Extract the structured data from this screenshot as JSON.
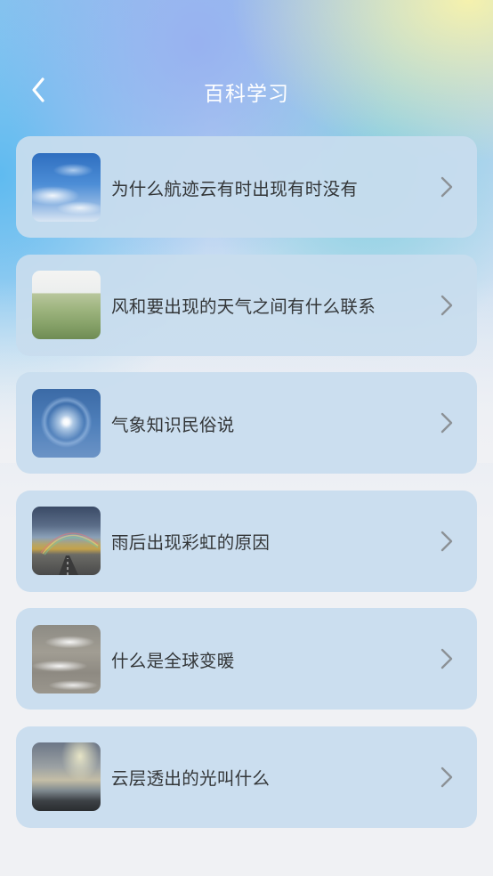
{
  "header": {
    "title": "百科学习",
    "back_icon": "chevron-left-icon"
  },
  "items": [
    {
      "label": "为什么航迹云有时出现有时没有",
      "image": "sky-clouds-image"
    },
    {
      "label": "风和要出现的天气之间有什么联系",
      "image": "grass-field-image"
    },
    {
      "label": "气象知识民俗说",
      "image": "sun-halo-image"
    },
    {
      "label": "雨后出现彩虹的原因",
      "image": "rainbow-road-image"
    },
    {
      "label": "什么是全球变暖",
      "image": "melting-ice-image"
    },
    {
      "label": "云层透出的光叫什么",
      "image": "sun-rays-clouds-image"
    }
  ],
  "colors": {
    "card_background": "#c8ddee",
    "title_text": "#ffffff",
    "item_text": "#333638",
    "chevron": "#8c9196"
  }
}
